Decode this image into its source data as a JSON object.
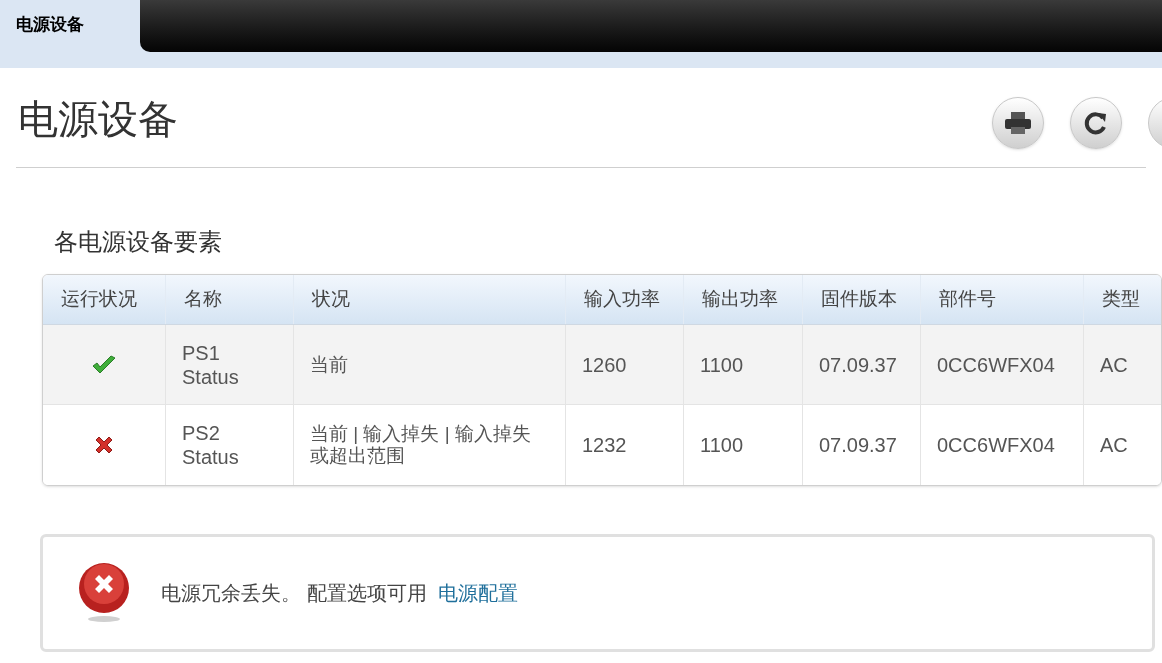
{
  "tabs": [
    {
      "label": "电源设备",
      "selected": true
    }
  ],
  "page_title": "电源设备",
  "section_title": "各电源设备要素",
  "table": {
    "columns": [
      "运行状况",
      "名称",
      "状况",
      "输入功率",
      "输出功率",
      "固件版本",
      "部件号",
      "类型"
    ],
    "rows": [
      {
        "kind": "ok",
        "name": [
          "PS1",
          "Status"
        ],
        "status": "当前",
        "input_power": "1260",
        "output_power": "1100",
        "firmware": "07.09.37",
        "part_number": "0CC6WFX04",
        "type": "AC"
      },
      {
        "kind": "error",
        "name": [
          "PS2",
          "Status"
        ],
        "status": "当前 | 输入掉失 | 输入掉失或超出范围",
        "input_power": "1232",
        "output_power": "1100",
        "firmware": "07.09.37",
        "part_number": "0CC6WFX04",
        "type": "AC"
      }
    ]
  },
  "alert": {
    "kind": "error",
    "message": "电源冗余丢失。 配置选项可用",
    "link": "电源配置"
  }
}
